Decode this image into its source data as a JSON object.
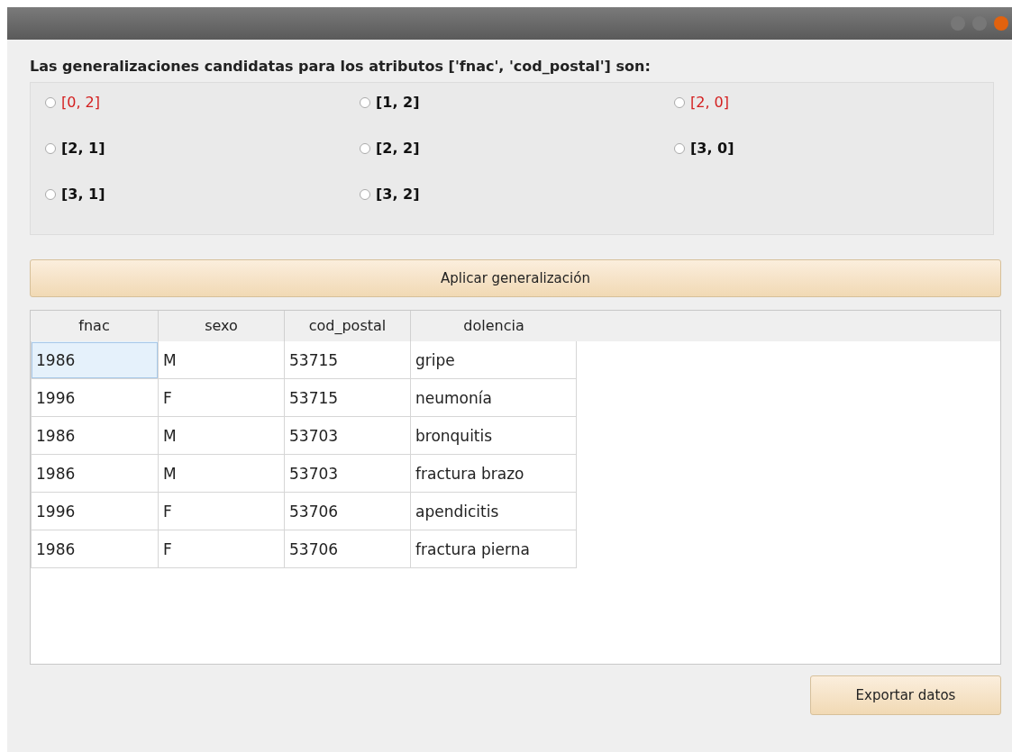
{
  "heading": "Las generalizaciones candidatas para los atributos ['fnac', 'cod_postal'] son:",
  "options": [
    {
      "label": "[0, 2]",
      "kind": "marked",
      "selected": false
    },
    {
      "label": "[1, 2]",
      "kind": "plain",
      "selected": false
    },
    {
      "label": "[2, 0]",
      "kind": "marked",
      "selected": false
    },
    {
      "label": "[2, 1]",
      "kind": "plain",
      "selected": false
    },
    {
      "label": "[2, 2]",
      "kind": "plain",
      "selected": false
    },
    {
      "label": "[3, 0]",
      "kind": "plain",
      "selected": false
    },
    {
      "label": "[3, 1]",
      "kind": "plain",
      "selected": false
    },
    {
      "label": "[3, 2]",
      "kind": "plain",
      "selected": false
    }
  ],
  "apply_button": "Aplicar generalización",
  "table": {
    "columns": [
      "fnac",
      "sexo",
      "cod_postal",
      "dolencia"
    ],
    "rows": [
      {
        "cells": [
          {
            "text": "1986",
            "selected": true
          },
          {
            "text": "M",
            "selected": false
          },
          {
            "text": "53715",
            "selected": false
          },
          {
            "text": "gripe",
            "selected": false
          }
        ]
      },
      {
        "cells": [
          {
            "text": "1996",
            "selected": false
          },
          {
            "text": "F",
            "selected": false
          },
          {
            "text": "53715",
            "selected": false
          },
          {
            "text": "neumonía",
            "selected": false
          }
        ]
      },
      {
        "cells": [
          {
            "text": "1986",
            "selected": false
          },
          {
            "text": "M",
            "selected": false
          },
          {
            "text": "53703",
            "selected": false
          },
          {
            "text": "bronquitis",
            "selected": false
          }
        ]
      },
      {
        "cells": [
          {
            "text": "1986",
            "selected": false
          },
          {
            "text": "M",
            "selected": false
          },
          {
            "text": "53703",
            "selected": false
          },
          {
            "text": "fractura brazo",
            "selected": false
          }
        ]
      },
      {
        "cells": [
          {
            "text": "1996",
            "selected": false
          },
          {
            "text": "F",
            "selected": false
          },
          {
            "text": "53706",
            "selected": false
          },
          {
            "text": "apendicitis",
            "selected": false
          }
        ]
      },
      {
        "cells": [
          {
            "text": "1986",
            "selected": false
          },
          {
            "text": "F",
            "selected": false
          },
          {
            "text": "53706",
            "selected": false
          },
          {
            "text": "fractura pierna",
            "selected": false
          }
        ]
      }
    ]
  },
  "export_button": "Exportar datos"
}
